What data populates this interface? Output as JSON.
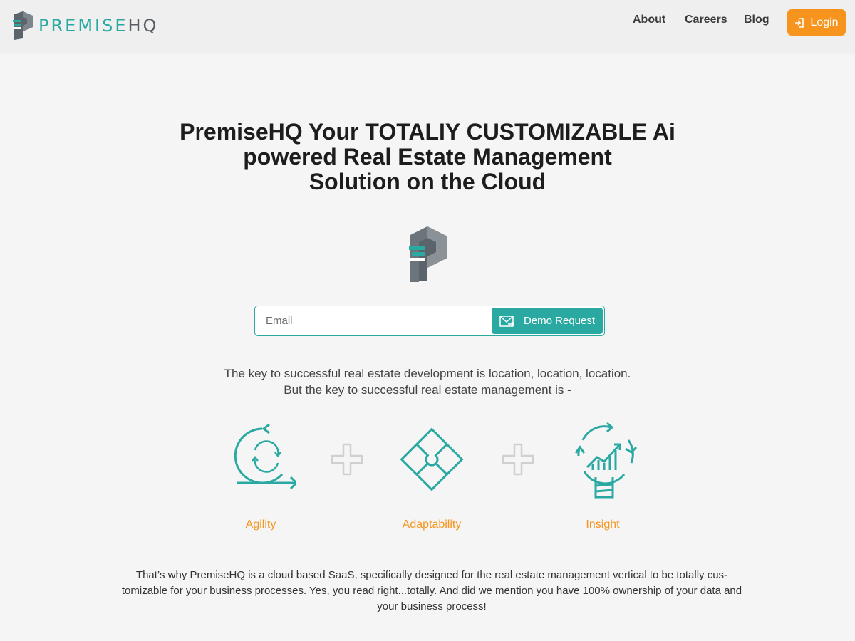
{
  "header": {
    "logo": {
      "brand_part1": "PREMISE",
      "brand_part2": "HQ",
      "icon": "premisehq-logo-icon"
    },
    "nav": {
      "about": "About",
      "careers": "Careers",
      "blog": "Blog"
    },
    "login": {
      "label": "Login",
      "icon": "login-arrow-icon"
    }
  },
  "hero": {
    "title_lines": [
      "PremiseHQ Your TOTALIY CUSTOMIZABLE Ai",
      "powered Real Estate Management",
      "Solution on the Cloud"
    ]
  },
  "form": {
    "email_placeholder": "Email",
    "email_value": "",
    "demo_button": "Demo Request",
    "demo_icon": "envelope-send-icon"
  },
  "tagline": {
    "line1": "The key to successful real estate development is location, location, location.",
    "line2": "But the key to successful real estate management is -"
  },
  "features": [
    {
      "label": "Agility",
      "icon": "agility-cycle-icon"
    },
    {
      "label": "Adaptability",
      "icon": "puzzle-icon"
    },
    {
      "label": "Insight",
      "icon": "lightbulb-chart-icon"
    }
  ],
  "footer_text": "That’s why PremiseHQ is a cloud based SaaS, specifically designed for the real estate management vertical to be totally cus-tomizable for your business processes. Yes, you read right...totally. And did we mention you have 100% ownership of your data and your business process!",
  "colors": {
    "teal": "#2aa9a2",
    "orange": "#f7941d",
    "slate": "#555d63"
  }
}
